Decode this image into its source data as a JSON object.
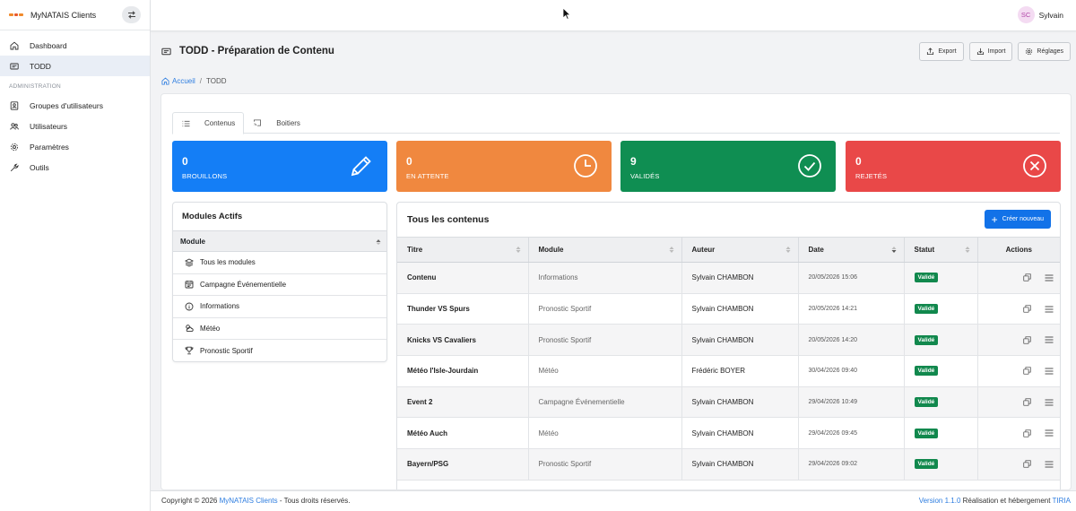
{
  "app": {
    "name": "MyNATAIS Clients"
  },
  "sidebar": {
    "items": [
      {
        "label": "Dashboard",
        "icon": "home-icon"
      },
      {
        "label": "TODD",
        "icon": "screen-icon"
      }
    ],
    "section_label": "ADMINISTRATION",
    "admin_items": [
      {
        "label": "Groupes d'utilisateurs",
        "icon": "user-badge-icon"
      },
      {
        "label": "Utilisateurs",
        "icon": "users-icon"
      },
      {
        "label": "Paramètres",
        "icon": "gear-icon"
      },
      {
        "label": "Outils",
        "icon": "wrench-icon"
      }
    ]
  },
  "header": {
    "user_initials": "SC",
    "user_name": "Sylvain"
  },
  "page": {
    "title": "TODD - Préparation de Contenu",
    "actions": {
      "export": "Export",
      "import": "Import",
      "settings": "Réglages"
    },
    "breadcrumb": {
      "home": "Accueil",
      "current": "TODD"
    }
  },
  "tabs": [
    {
      "label": "Contenus"
    },
    {
      "label": "Boitiers"
    }
  ],
  "stats": [
    {
      "value": "0",
      "label": "BROUILLONS",
      "color": "#147ef6",
      "icon": "pencil-icon"
    },
    {
      "value": "0",
      "label": "EN ATTENTE",
      "color": "#f0883f",
      "icon": "clock-icon"
    },
    {
      "value": "9",
      "label": "VALIDÉS",
      "color": "#0f8e52",
      "icon": "check-circle-icon"
    },
    {
      "value": "0",
      "label": "REJETÉS",
      "color": "#e94848",
      "icon": "x-circle-icon"
    }
  ],
  "modules": {
    "title": "Modules Actifs",
    "column": "Module",
    "items": [
      {
        "label": "Tous les modules",
        "icon": "layers-icon"
      },
      {
        "label": "Campagne Événementielle",
        "icon": "calendar-icon"
      },
      {
        "label": "Informations",
        "icon": "info-icon"
      },
      {
        "label": "Météo",
        "icon": "weather-icon"
      },
      {
        "label": "Pronostic Sportif",
        "icon": "trophy-icon"
      }
    ]
  },
  "table": {
    "title": "Tous les contenus",
    "create_label": "Créer nouveau",
    "columns": {
      "title": "Titre",
      "module": "Module",
      "author": "Auteur",
      "date": "Date",
      "status": "Statut",
      "actions": "Actions"
    },
    "rows": [
      {
        "title": "Contenu",
        "module": "Informations",
        "author": "Sylvain CHAMBON",
        "date": "20/05/2026 15:06",
        "status": "Validé"
      },
      {
        "title": "Thunder VS Spurs",
        "module": "Pronostic Sportif",
        "author": "Sylvain CHAMBON",
        "date": "20/05/2026 14:21",
        "status": "Validé"
      },
      {
        "title": "Knicks VS Cavaliers",
        "module": "Pronostic Sportif",
        "author": "Sylvain CHAMBON",
        "date": "20/05/2026 14:20",
        "status": "Validé"
      },
      {
        "title": "Météo l'Isle-Jourdain",
        "module": "Météo",
        "author": "Frédéric BOYER",
        "date": "30/04/2026 09:40",
        "status": "Validé"
      },
      {
        "title": "Event 2",
        "module": "Campagne Événementielle",
        "author": "Sylvain CHAMBON",
        "date": "29/04/2026 10:49",
        "status": "Validé"
      },
      {
        "title": "Météo Auch",
        "module": "Météo",
        "author": "Sylvain CHAMBON",
        "date": "29/04/2026 09:45",
        "status": "Validé"
      },
      {
        "title": "Bayern/PSG",
        "module": "Pronostic Sportif",
        "author": "Sylvain CHAMBON",
        "date": "29/04/2026 09:02",
        "status": "Validé"
      }
    ]
  },
  "footer": {
    "copyright_prefix": "Copyright © 2026",
    "brand": "MyNATAIS Clients",
    "rights": "- Tous droits réservés.",
    "version": "Version 1.1.0",
    "credit": "Réalisation et hébergement",
    "company": "TIRIA"
  }
}
